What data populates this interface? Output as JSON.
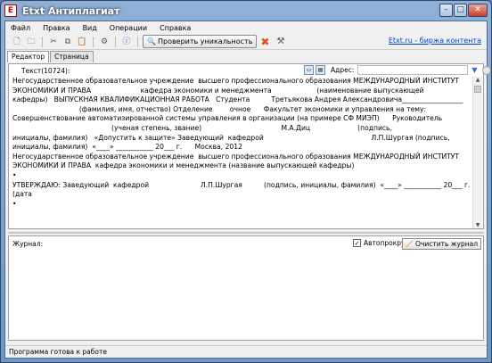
{
  "window": {
    "title": "Etxt Антиплагиат"
  },
  "menu": [
    "Файл",
    "Правка",
    "Вид",
    "Операции",
    "Справка"
  ],
  "toolbar": {
    "check_button": "Проверить уникальность",
    "link": "Etxt.ru - биржа контента"
  },
  "tabs": [
    "Редактор",
    "Страница"
  ],
  "editor": {
    "text_label": "Текст(10724):",
    "address_label": "Адрес:",
    "address_value": "",
    "lines": [
      "Негосударственное образовательное учреждение  высшего профессионального образования МЕЖДУНАРОДНЫЙ ИНСТИТУТ",
      "ЭКОНОМИКИ И ПРАВА                       кафедра экономики и менеджмента                     (наименование выпускающей",
      "кафедры)   ВЫПУСКНАЯ КВАЛИФИКАЦИОННАЯ РАБОТА   Студента          Третьякова Андрея Александровича__________________",
      "                               (фамилия, имя, отчество) Отделение        очное      Факультет экономики и управления на тему:",
      "Совершенствование автоматизированной системы управления в организации (на примере СФ МИЭП)      Руководитель",
      "                                              (ученая степень, звание)                                     М.А.Диц                      (подпись,",
      "инициалы, фамилия)   «Допустить к защите» Заведующий  кафедрой                                                  Л.П.Шургая (подпись,",
      "инициалы, фамилия)  «____» ___________ 20___ г.      Москва, 2012",
      "Негосударственное образовательное учреждение  высшего профессионального образования МЕЖДУНАРОДНЫЙ ИНСТИТУТ",
      "ЭКОНОМИКИ И ПРАВА  кафедра экономики и менеджмента (название выпускающей кафедры)",
      "•",
      "УТВЕРЖДАЮ: Заведующий  кафедрой                        Л.П.Шургая          (подпись, инициалы, фамилия)  «____» ___________ 20___ г.",
      "(дата",
      "•"
    ]
  },
  "journal": {
    "label": "Журнал:",
    "autoscroll_label": "Автопрокрутка",
    "autoscroll_checked": true,
    "clear_button": "Очистить журнал"
  },
  "status": {
    "text": "Программа готова к работе"
  },
  "colors": {
    "title_gradient_top": "#8fb0d6",
    "link": "#0044cc",
    "stop_icon": "#d9531e"
  },
  "icons": [
    "app-logo-icon",
    "new-file-icon",
    "open-file-icon",
    "cut-icon",
    "copy-icon",
    "paste-icon",
    "settings-icon",
    "info-icon",
    "search-icon",
    "stop-icon",
    "tools-icon",
    "dropdown-arrow-icon",
    "go-icon",
    "clear-journal-icon"
  ]
}
